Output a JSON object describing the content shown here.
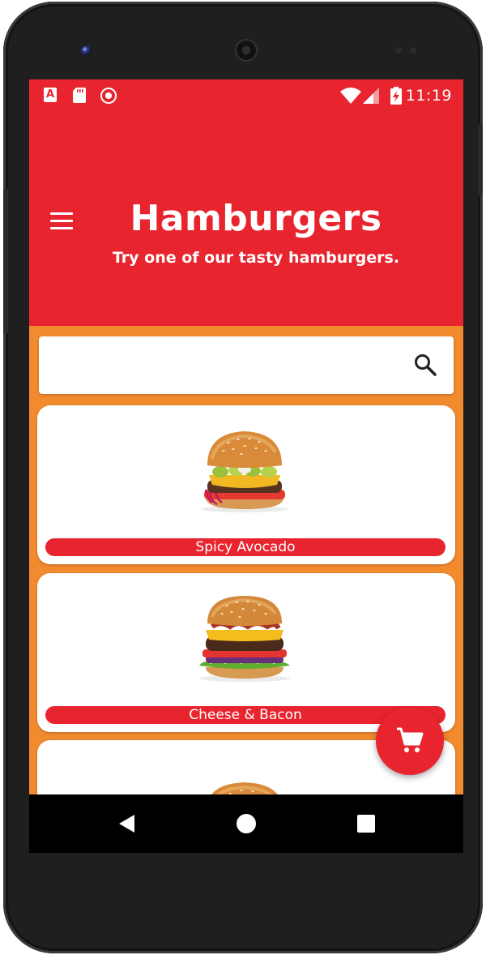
{
  "status_bar": {
    "notification_icons": [
      "accessibility-a-icon",
      "sd-card-icon",
      "screen-record-icon"
    ],
    "system_icons": [
      "wifi-icon",
      "cell-signal-icon",
      "battery-charging-icon"
    ],
    "time": "11:19",
    "a_icon_glyph": "A"
  },
  "header": {
    "title": "Hamburgers",
    "subtitle": "Try one of our tasty hamburgers.",
    "menu_icon": "hamburger-menu-icon"
  },
  "search": {
    "value": "",
    "placeholder": "",
    "icon": "search-icon"
  },
  "burgers": [
    {
      "name": "Spicy Avocado",
      "image": "spicy-avocado-burger-image"
    },
    {
      "name": "Cheese & Bacon",
      "image": "cheese-bacon-burger-image"
    },
    {
      "name": "",
      "image": "burger-image"
    }
  ],
  "fab": {
    "icon": "shopping-cart-icon"
  },
  "nav_bar": {
    "icons": [
      "back-triangle-icon",
      "home-circle-icon",
      "recents-square-icon"
    ]
  },
  "colors": {
    "primary": "#e8252f",
    "background": "#f28a2e",
    "card": "#ffffff",
    "nav": "#000000"
  }
}
